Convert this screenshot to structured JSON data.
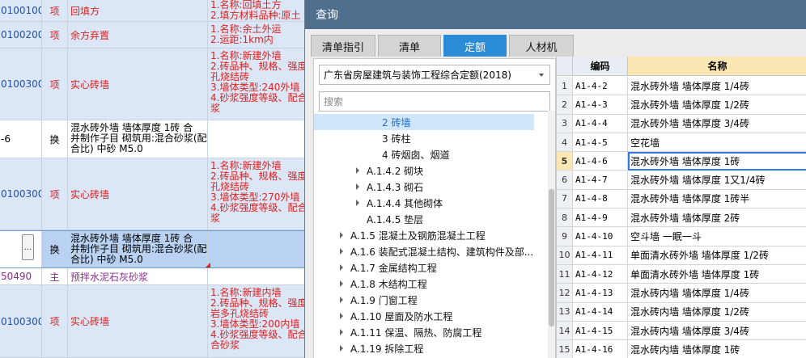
{
  "bg_rows": [
    {
      "code": "01001002",
      "type": "项",
      "name": "回填方",
      "features": "1.名称:回填土方\n2.填方材料品种:原土"
    },
    {
      "code": "01002002",
      "type": "项",
      "name": "余方弃置",
      "features": "1.名称:余土外运\n2.运距:1km内"
    },
    {
      "code": "01003007",
      "type": "项",
      "name": "实心砖墙",
      "features": "1.名称:新建外墙\n2.砖品种、规格、强度\n孔烧结砖\n3.墙体类型:240外墙\n4.砂浆强度等级、配合\n浆"
    },
    {
      "code": "-6",
      "type": "换",
      "name": "混水砖外墙 墙体厚度 1砖  合\n并制作子目 砌筑用:混合砂浆(配\n合比) 中砂 M5.0",
      "features": ""
    },
    {
      "code": "01003009",
      "type": "项",
      "name": "实心砖墙",
      "features": "1.名称:新建外墙\n2.砖品种、规格、强度\n孔烧结砖\n3.墙体类型:270外墙\n4.砂浆强度等级、配合\n浆"
    },
    {
      "code": "...",
      "type": "换",
      "name": "混水砖外墙 墙体厚度 1砖  合\n并制作子目 砌筑用:混合砂浆(配\n合比) 中砂 M5.0",
      "features": ""
    },
    {
      "code": "50490",
      "type": "主",
      "name": "预拌水泥石灰砂浆",
      "features": ""
    },
    {
      "code": "01003008",
      "type": "项",
      "name": "实心砖墙",
      "features": "1.名称:新建内墙\n2.砖品种、规格、强度\n岩多孔烧结砖\n3.墙体类型:200内墙\n4.砂浆强度等级、配合\n合砂浆"
    }
  ],
  "dialog": {
    "title": "查询",
    "tabs": [
      "清单指引",
      "清单",
      "定额",
      "人材机"
    ],
    "active_tab": "定额",
    "dropdown_value": "广东省房屋建筑与装饰工程综合定额(2018)",
    "search_placeholder": "搜索",
    "tree": [
      {
        "label": "2 砖墙",
        "expandable": false,
        "selected": true,
        "level": 3
      },
      {
        "label": "3 砖柱",
        "expandable": false,
        "selected": false,
        "level": 3
      },
      {
        "label": "4 砖烟囱、烟道",
        "expandable": false,
        "selected": false,
        "level": 3
      },
      {
        "label": "A.1.4.2 砌块",
        "expandable": true,
        "selected": false,
        "level": 2
      },
      {
        "label": "A.1.4.3 砌石",
        "expandable": true,
        "selected": false,
        "level": 2
      },
      {
        "label": "A.1.4.4 其他砌体",
        "expandable": true,
        "selected": false,
        "level": 2
      },
      {
        "label": "A.1.4.5 垫层",
        "expandable": false,
        "selected": false,
        "level": 2
      },
      {
        "label": "A.1.5 混凝土及钢筋混凝土工程",
        "expandable": true,
        "selected": false,
        "level": 1
      },
      {
        "label": "A.1.6 装配式混凝土结构、建筑构件及部...",
        "expandable": true,
        "selected": false,
        "level": 1
      },
      {
        "label": "A.1.7 金属结构工程",
        "expandable": true,
        "selected": false,
        "level": 1
      },
      {
        "label": "A.1.8 木结构工程",
        "expandable": true,
        "selected": false,
        "level": 1
      },
      {
        "label": "A.1.9 门窗工程",
        "expandable": true,
        "selected": false,
        "level": 1
      },
      {
        "label": "A.1.10 屋面及防水工程",
        "expandable": true,
        "selected": false,
        "level": 1
      },
      {
        "label": "A.1.11 保温、隔热、防腐工程",
        "expandable": true,
        "selected": false,
        "level": 1
      },
      {
        "label": "A.1.19 拆除工程",
        "expandable": true,
        "selected": false,
        "level": 1
      }
    ],
    "table": {
      "headers": {
        "code": "编码",
        "name": "名称"
      },
      "selected_row": 5,
      "rows": [
        {
          "num": "1",
          "code": "A1-4-2",
          "name": "混水砖外墙 墙体厚度 1/4砖"
        },
        {
          "num": "2",
          "code": "A1-4-3",
          "name": "混水砖外墙 墙体厚度 1/2砖"
        },
        {
          "num": "3",
          "code": "A1-4-4",
          "name": "混水砖外墙 墙体厚度 3/4砖"
        },
        {
          "num": "4",
          "code": "A1-4-5",
          "name": "空花墙"
        },
        {
          "num": "5",
          "code": "A1-4-6",
          "name": "混水砖外墙 墙体厚度 1砖"
        },
        {
          "num": "6",
          "code": "A1-4-7",
          "name": "混水砖外墙 墙体厚度 1又1/4砖"
        },
        {
          "num": "7",
          "code": "A1-4-8",
          "name": "混水砖外墙 墙体厚度 1砖半"
        },
        {
          "num": "8",
          "code": "A1-4-9",
          "name": "混水砖外墙 墙体厚度 2砖"
        },
        {
          "num": "9",
          "code": "A1-4-10",
          "name": "空斗墙 一眠一斗"
        },
        {
          "num": "10",
          "code": "A1-4-11",
          "name": "单面清水砖外墙 墙体厚度 1/2砖"
        },
        {
          "num": "11",
          "code": "A1-4-12",
          "name": "单面清水砖外墙 墙体厚度 1砖"
        },
        {
          "num": "12",
          "code": "A1-4-13",
          "name": "混水砖内墙 墙体厚度 1/4砖"
        },
        {
          "num": "13",
          "code": "A1-4-14",
          "name": "混水砖内墙 墙体厚度 1/2砖"
        },
        {
          "num": "14",
          "code": "A1-4-15",
          "name": "混水砖内墙 墙体厚度 3/4砖"
        },
        {
          "num": "15",
          "code": "A1-4-16",
          "name": "混水砖内墙 墙体厚度 1砖"
        }
      ]
    }
  }
}
